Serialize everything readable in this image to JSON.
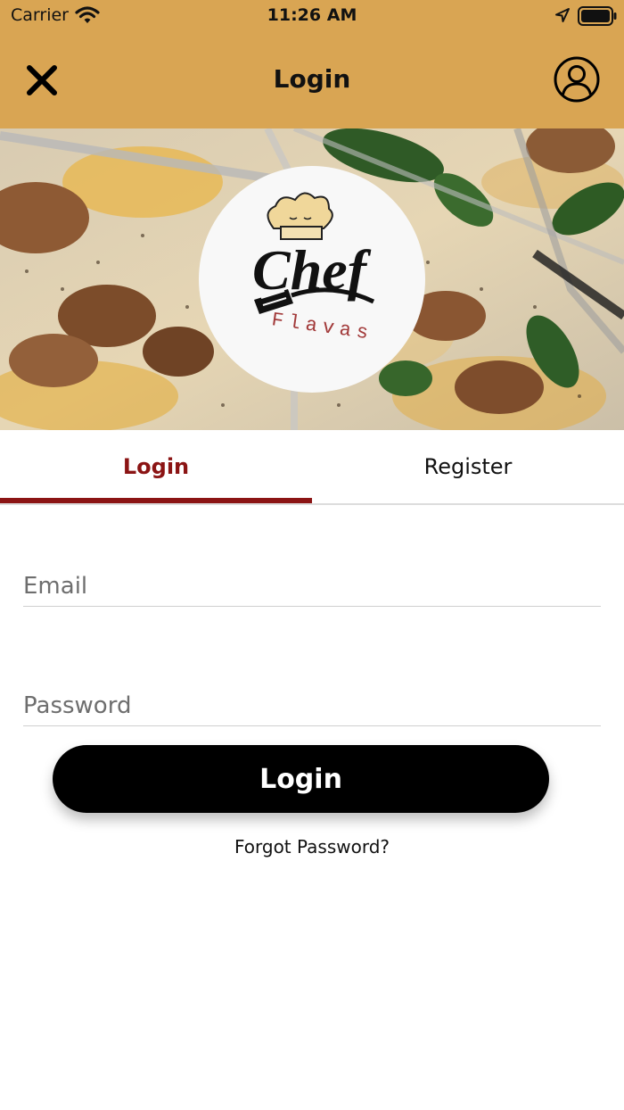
{
  "status_bar": {
    "carrier": "Carrier",
    "time": "11:26 AM",
    "icons": [
      "wifi-icon",
      "location-icon",
      "battery-icon"
    ]
  },
  "nav": {
    "title": "Login",
    "left_icon": "close-icon",
    "right_icon": "user-profile-icon"
  },
  "logo": {
    "line1": "Chef",
    "line2": "Flavas"
  },
  "tabs": [
    {
      "label": "Login",
      "active": true
    },
    {
      "label": "Register",
      "active": false
    }
  ],
  "form": {
    "email_placeholder": "Email",
    "email_value": "",
    "password_placeholder": "Password",
    "password_value": "",
    "submit_label": "Login",
    "forgot_label": "Forgot Password?"
  },
  "colors": {
    "header_bg": "#d9a553",
    "accent": "#8b1414",
    "button_bg": "#000000",
    "button_text": "#ffffff"
  }
}
